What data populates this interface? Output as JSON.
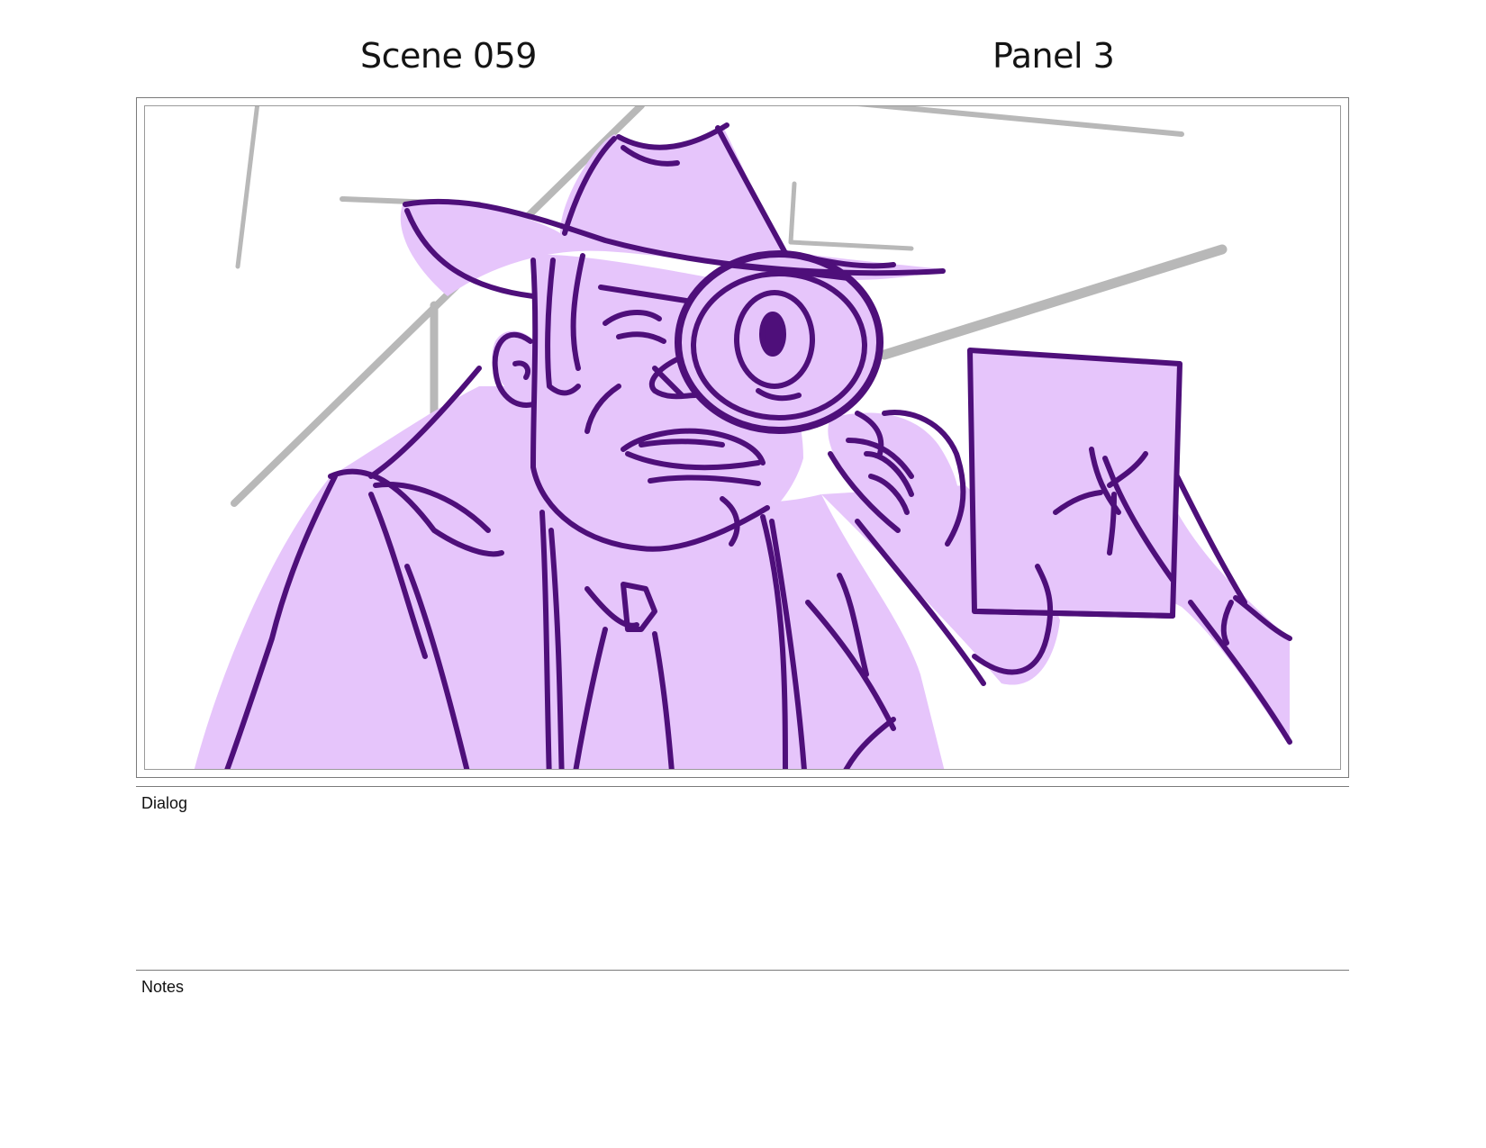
{
  "header": {
    "scene": "Scene 059",
    "panel": "Panel 3"
  },
  "panel": {
    "description_icon": "storyboard-sketch-detective-magnifying-glass",
    "colors": {
      "ink": "#4e0f7a",
      "fill": "#e6c5fb",
      "background_lines": "#b8b8b8",
      "frame": "#7a7a7a"
    }
  },
  "sections": {
    "dialog_label": "Dialog",
    "dialog_text": "",
    "notes_label": "Notes",
    "notes_text": ""
  }
}
